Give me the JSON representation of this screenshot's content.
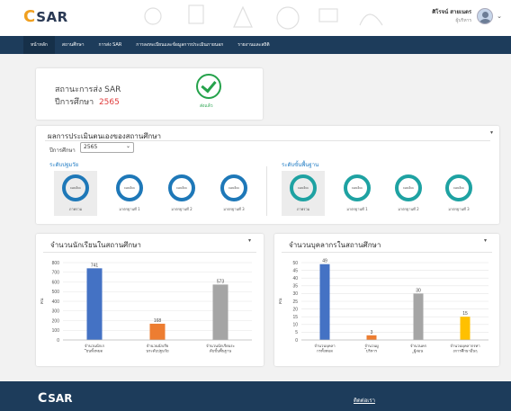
{
  "header": {
    "logo_mark": "C",
    "logo_text": "SAR",
    "user_name": "ศิโรจน์ สายเนตร",
    "user_role": "ผู้บริหาร",
    "caret": "⌄"
  },
  "nav": {
    "items": [
      {
        "label": "หน้าหลัก"
      },
      {
        "label": "สถานศึกษา"
      },
      {
        "label": "การส่ง SAR"
      },
      {
        "label": "การลงทะเบียนและข้อมูลการประเมินภายนอก"
      },
      {
        "label": "รายงานและสถิติ"
      }
    ]
  },
  "sar_status": {
    "title": "สถานะการส่ง SAR",
    "year_prefix": "ปีการศึกษา",
    "year": "2565",
    "status": "ส่งแล้ว",
    "status_color": "#25a24b"
  },
  "evaluation": {
    "title": "ผลการประเมินตนเองของสถานศึกษา",
    "year_label": "ปีการศึกษา",
    "year_value": "2565",
    "left_group_label": "ระดับปฐมวัย",
    "right_group_label": "ระดับขั้นพื้นฐาน",
    "gauge_text": "ยอดเยี่ยม",
    "left_items": [
      "ภาพรวม",
      "มาตรฐานที่ 1",
      "มาตรฐานที่ 2",
      "มาตรฐานที่ 3"
    ],
    "right_items": [
      "ภาพรวม",
      "มาตรฐานที่ 1",
      "มาตรฐานที่ 2",
      "มาตรฐานที่ 3"
    ]
  },
  "students_panel": {
    "title": "จำนวนนักเรียนในสถานศึกษา"
  },
  "staff_panel": {
    "title": "จำนวนบุคลากรในสถานศึกษา"
  },
  "chart_data": [
    {
      "type": "bar",
      "categories": [
        "จำนวนนักเรียนทั้งหมด",
        "จำนวนนักเรียนระดับปฐมวัย",
        "จำนวนนักเรียนระดับขั้นพื้นฐาน"
      ],
      "values": [
        741,
        168,
        573
      ],
      "ylabel": "คน",
      "ylim": [
        0,
        800
      ],
      "yticks": [
        0,
        100,
        200,
        300,
        400,
        500,
        600,
        700,
        800
      ],
      "colors": [
        "#4472c4",
        "#ed7d31",
        "#a5a5a5"
      ],
      "grid": true
    },
    {
      "type": "bar",
      "categories": [
        "จำนวนบุคลากรทั้งหมด",
        "จำนวนผู้บริหาร",
        "จำนวนครูผู้สอน",
        "จำนวนบุคลากรทางการศึกษาอื่นๆ"
      ],
      "values": [
        49,
        3,
        30,
        15
      ],
      "ylabel": "คน",
      "ylim": [
        0,
        50
      ],
      "yticks": [
        0,
        5,
        10,
        15,
        20,
        25,
        30,
        35,
        40,
        45,
        50
      ],
      "colors": [
        "#4472c4",
        "#ed7d31",
        "#a5a5a5",
        "#ffc000"
      ],
      "grid": true
    }
  ],
  "footer": {
    "logo_mark": "C",
    "logo_text": "SAR",
    "contact": "ติดต่อเรา"
  }
}
